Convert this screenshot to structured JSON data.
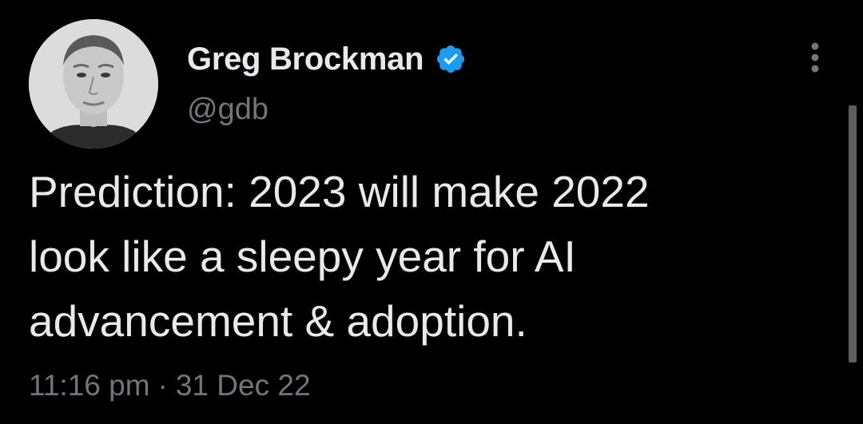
{
  "author": {
    "display_name": "Greg Brockman",
    "handle": "@gdb",
    "verified_icon": "verified-badge-icon"
  },
  "tweet": {
    "text": "Prediction: 2023 will make 2022\nlook like a sleepy year for AI\nadvancement & adoption.",
    "time": "11:16 pm",
    "separator": "·",
    "date": "31 Dec 22"
  },
  "icons": {
    "more": "more-options-icon",
    "avatar": "avatar"
  },
  "colors": {
    "background": "#000000",
    "primary_text": "#e7e9ea",
    "secondary_text": "#71767b",
    "verified_blue": "#1d9bf0",
    "scrollbar": "#5e5e5e"
  }
}
